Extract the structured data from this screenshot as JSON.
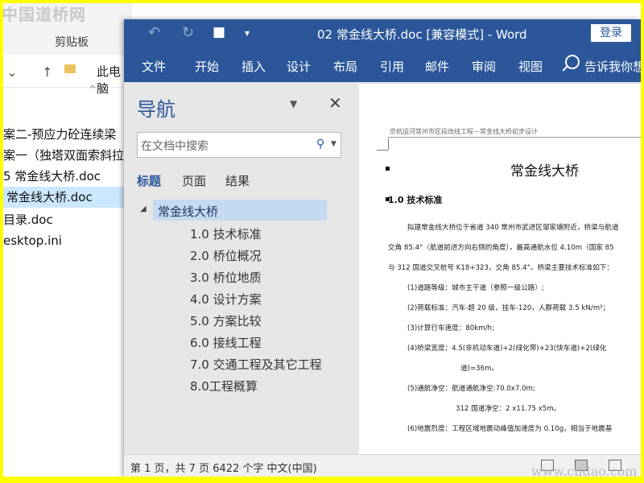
{
  "watermarks": {
    "top_left": "中国道桥网",
    "bottom_right": "www.cndao.com"
  },
  "explorer": {
    "clipboard_label": "剪贴板",
    "address_path": "此电脑",
    "files": [
      {
        "name": "案二-预应力砼连续梁",
        "selected": false
      },
      {
        "name": "案一（独塔双面索斜拉",
        "selected": false
      },
      {
        "name": "5 常金线大桥.doc",
        "selected": false
      },
      {
        "name": "常金线大桥.doc",
        "selected": true
      },
      {
        "name": "目录.doc",
        "selected": false
      },
      {
        "name": "esktop.ini",
        "selected": false
      }
    ]
  },
  "word": {
    "title": "02 常金线大桥.doc [兼容模式]  -  Word",
    "login_label": "登录",
    "ribbon_tabs": [
      "文件",
      "开始",
      "插入",
      "设计",
      "布局",
      "引用",
      "邮件",
      "审阅",
      "视图"
    ],
    "tell_me": "告诉我你想",
    "nav": {
      "title": "导航",
      "search_placeholder": "在文档中搜索",
      "tabs": [
        "标题",
        "页面",
        "结果"
      ],
      "heading": "常金线大桥",
      "subheadings": [
        "1.0 技术标准",
        "2.0 桥位概况",
        "3.0 桥位地质",
        "4.0 设计方案",
        "5.0 方案比较",
        "6.0 接线工程",
        "7.0 交通工程及其它工程",
        "8.0工程概算"
      ]
    },
    "doc": {
      "header": "京杭运河常州市区段改线工程—常金线大桥初步设计",
      "title": "常金线大桥",
      "section": "1.0 技术标准",
      "lines": [
        "拟建常金线大桥位于省道 340 常州市武进区邹家塘附近，桥梁与航道",
        "交角 85.4°（航道前进方向右侧的角度），最高通航水位 4.10m（国家 85",
        "与 312 国道交叉桩号 K18+323，交角 85.4°。桥梁主要技术标准如下：",
        "(1)道路等级：城市主干道（参照一级公路）;",
        "(2)荷载标准：汽车-超 20 级，挂车-120，人群荷载 3.5 kN/m²；",
        "(3)计算行车速度：80km/h;",
        "(4)桥梁宽度：4.5(非机动车道)+2(绿化带)+23(快车道)+2(绿化",
        "道)=36m。",
        "(5)通航净空：航道通航净空:70.0x7.0m;",
        "312 国道净空：2 x11.75 x5m。",
        "(6)地震烈度：工程区域地震动峰值加速度为 0.10g，相当于地震基"
      ]
    },
    "status": "第 1 页，共 7 页    6422 个字    中文(中国)"
  }
}
